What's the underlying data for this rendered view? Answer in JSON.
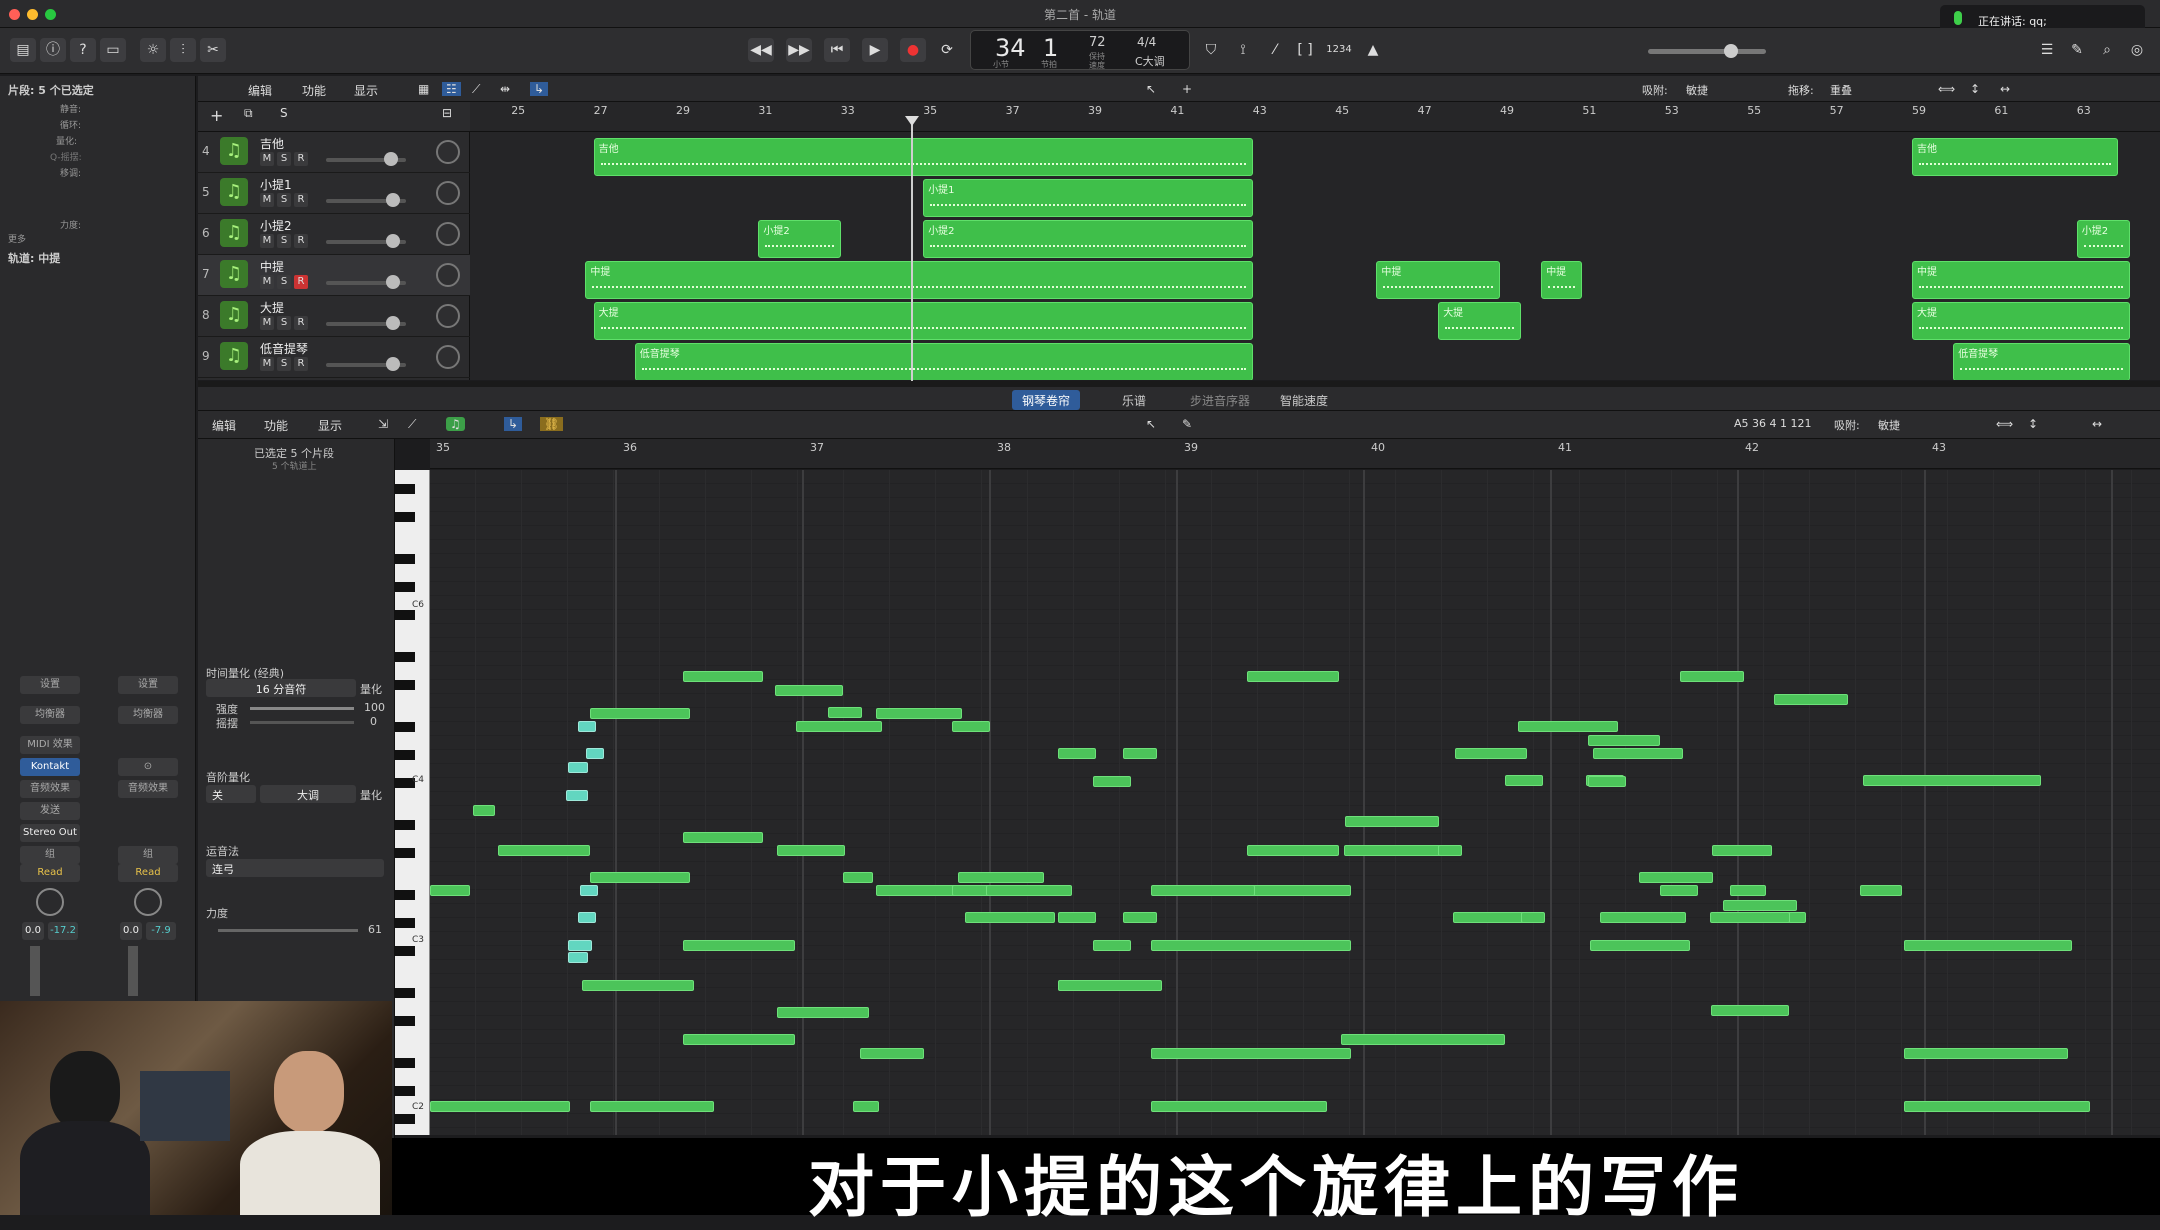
{
  "window": {
    "title": "第二首 - 轨道"
  },
  "control_bar": {
    "lcd": {
      "bar": "34",
      "beat": "1",
      "bar_label": "小节",
      "beat_label": "节拍",
      "tempo": "72",
      "tempo_label": "保持",
      "tempo_sub": "速度",
      "time_signature": "4/4",
      "key": "C大调"
    },
    "count_in": "1234",
    "mic_status": "正在讲话: qq;"
  },
  "inspector": {
    "region_header": "片段: 5 个已选定",
    "fields": [
      "静音:",
      "循环:",
      "量化:",
      "Q-摇摆:",
      "移调:",
      "力度:"
    ],
    "more_label": "更多",
    "track_header": "轨道: 中提",
    "channel_strips": [
      {
        "setting": "设置",
        "eq": "均衡器",
        "midi_fx": "MIDI 效果",
        "instrument": "Kontakt",
        "audio_fx": "音频效果",
        "send": "发送",
        "output": "Stereo Out",
        "group": "组",
        "automation": "Read",
        "pan": "0.0",
        "level": "-17.2"
      },
      {
        "setting": "设置",
        "eq": "均衡器",
        "midi_fx": "",
        "instrument": "",
        "audio_fx": "音频效果",
        "send": "",
        "output": "",
        "group": "组",
        "automation": "Read",
        "pan": "0.0",
        "level": "-7.9"
      }
    ]
  },
  "tracks_toolbar": {
    "edit": "编辑",
    "functions": "功能",
    "view": "显示",
    "snap_label": "吸附:",
    "snap_value": "敏捷",
    "drag_label": "拖移:",
    "drag_value": "重叠"
  },
  "tracks": [
    {
      "num": "4",
      "name": "吉他",
      "m": "M",
      "s": "S",
      "r": "R"
    },
    {
      "num": "5",
      "name": "小提1",
      "m": "M",
      "s": "S",
      "r": "R"
    },
    {
      "num": "6",
      "name": "小提2",
      "m": "M",
      "s": "S",
      "r": "R"
    },
    {
      "num": "7",
      "name": "中提",
      "m": "M",
      "s": "S",
      "r": "R"
    },
    {
      "num": "8",
      "name": "大提",
      "m": "M",
      "s": "S",
      "r": "R"
    },
    {
      "num": "9",
      "name": "低音提琴",
      "m": "M",
      "s": "S",
      "r": "R"
    }
  ],
  "arrange_ruler": [
    "25",
    "27",
    "29",
    "31",
    "33",
    "35",
    "37",
    "39",
    "41",
    "43",
    "45",
    "47",
    "49",
    "51",
    "53",
    "55",
    "57",
    "59",
    "61",
    "63"
  ],
  "regions": [
    {
      "track": 0,
      "name": "吉他",
      "start": 27,
      "end": 43
    },
    {
      "track": 0,
      "name": "吉他",
      "start": 59,
      "end": 64
    },
    {
      "track": 1,
      "name": "小提1",
      "start": 35,
      "end": 43
    },
    {
      "track": 2,
      "name": "小提2",
      "start": 31,
      "end": 33
    },
    {
      "track": 2,
      "name": "小提2",
      "start": 35,
      "end": 43
    },
    {
      "track": 2,
      "name": "小提2",
      "start": 63,
      "end": 64.3
    },
    {
      "track": 3,
      "name": "中提",
      "start": 26.8,
      "end": 43
    },
    {
      "track": 3,
      "name": "中提",
      "start": 46,
      "end": 49
    },
    {
      "track": 3,
      "name": "中提",
      "start": 50,
      "end": 51
    },
    {
      "track": 3,
      "name": "中提",
      "start": 59,
      "end": 64.3
    },
    {
      "track": 4,
      "name": "大提",
      "start": 27,
      "end": 43
    },
    {
      "track": 4,
      "name": "大提",
      "start": 47.5,
      "end": 49.5
    },
    {
      "track": 4,
      "name": "大提",
      "start": 59,
      "end": 64.3
    },
    {
      "track": 5,
      "name": "低音提琴",
      "start": 28,
      "end": 43
    },
    {
      "track": 5,
      "name": "低音提琴",
      "start": 60,
      "end": 64.3
    }
  ],
  "editor_tabs": [
    "钢琴卷帘",
    "乐谱",
    "步进音序器",
    "智能速度"
  ],
  "editor_toolbar": {
    "edit": "编辑",
    "functions": "功能",
    "view": "显示",
    "position": "A5  36 4 1 121",
    "snap_label": "吸附:",
    "snap_value": "敏捷"
  },
  "editor_inspector": {
    "selection": "已选定 5 个片段",
    "selection_sub": "5 个轨道上",
    "time_quantize_label": "时间量化 (经典)",
    "time_quantize_value": "16 分音符",
    "quantize_button": "量化",
    "strength_label": "强度",
    "strength_value": "100",
    "swing_label": "摇摆",
    "swing_value": "0",
    "scale_quantize_label": "音阶量化",
    "scale_off": "关",
    "scale_value": "大调",
    "articulation_label": "运音法",
    "articulation_value": "连弓",
    "velocity_label": "力度",
    "velocity_value": "61"
  },
  "piano_roll_ruler": [
    "35",
    "36",
    "37",
    "38",
    "39",
    "40",
    "41",
    "42",
    "43"
  ],
  "keyboard_labels": [
    "C6",
    "C4",
    "C3",
    "C2"
  ],
  "notes": [
    [
      35.0,
      5.8,
      1.0,
      0.0
    ],
    [
      35.2,
      14.8,
      0.4,
      0.0
    ],
    [
      35.0,
      8.8,
      0.1,
      0.0
    ],
    [
      35.1,
      15.8,
      0.5,
      0.0
    ],
    [
      35.2,
      16.8,
      0.3,
      0.0
    ],
    [
      35.7,
      5.0,
      0.4,
      0.0
    ],
    [
      35.5,
      3.0,
      0.4,
      0.0
    ],
    [
      35.7,
      10.5,
      0.4,
      0.0
    ],
    [
      35.6,
      16.2,
      0.6,
      0.0
    ],
    [
      35.0,
      2.0,
      0.4,
      0.0
    ],
    [
      36.0,
      7.0,
      0.4,
      0.0
    ],
    [
      35.5,
      18.0,
      0.4,
      0.0
    ],
    [
      36.0,
      17.0,
      0.6,
      0.0
    ],
    [
      34.5,
      9.5,
      0.1,
      1
    ],
    [
      34.5,
      10.5,
      0.1,
      1
    ],
    [
      34.5,
      13.5,
      0.1,
      1
    ],
    [
      34.5,
      14.5,
      0.1,
      1
    ]
  ],
  "subtitle": "对于小提的这个旋律上的写作"
}
